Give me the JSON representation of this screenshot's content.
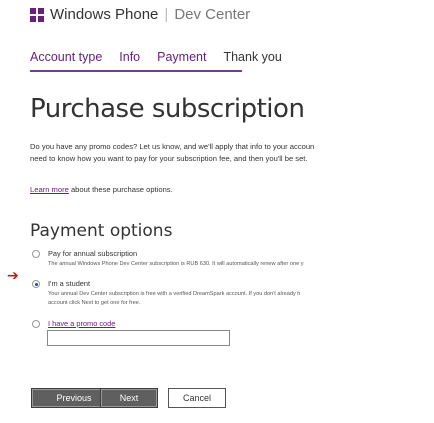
{
  "header": {
    "brand": "Windows Phone",
    "section": "Dev Center"
  },
  "tabs": [
    {
      "label": "Account type"
    },
    {
      "label": "Info"
    },
    {
      "label": "Payment"
    },
    {
      "label": "Thank you"
    }
  ],
  "page": {
    "title": "Purchase subscription",
    "intro_line1": "Do you have any promo codes? Let us know, and we'll apply that info to your accoun",
    "intro_line2": "need to know how you want to pay for your subscription fee, and then you'll be set.",
    "learn_more_link": "Learn more",
    "learn_more_rest": " about these purchase options."
  },
  "payment": {
    "heading": "Payment options",
    "options": [
      {
        "label": "Pay for annual subscription",
        "desc": [
          "The annual Windows Phone Dev Center subscription is RUB 630. It will automatically renew after one y"
        ]
      },
      {
        "label": "I'm a student",
        "desc": [
          "Your annual Dev Center subscription is free with a verified DreamSpark account. If you don't already h",
          "account click Next to get one for free."
        ]
      },
      {
        "label": "I have a promo code",
        "desc": []
      }
    ],
    "promo_value": "",
    "arrow_glyph": "➔"
  },
  "buttons": {
    "previous": "Previous",
    "next": "Next",
    "cancel": "Cancel"
  },
  "colors": {
    "accent": "#68217a",
    "arrow": "#c41a1a"
  }
}
